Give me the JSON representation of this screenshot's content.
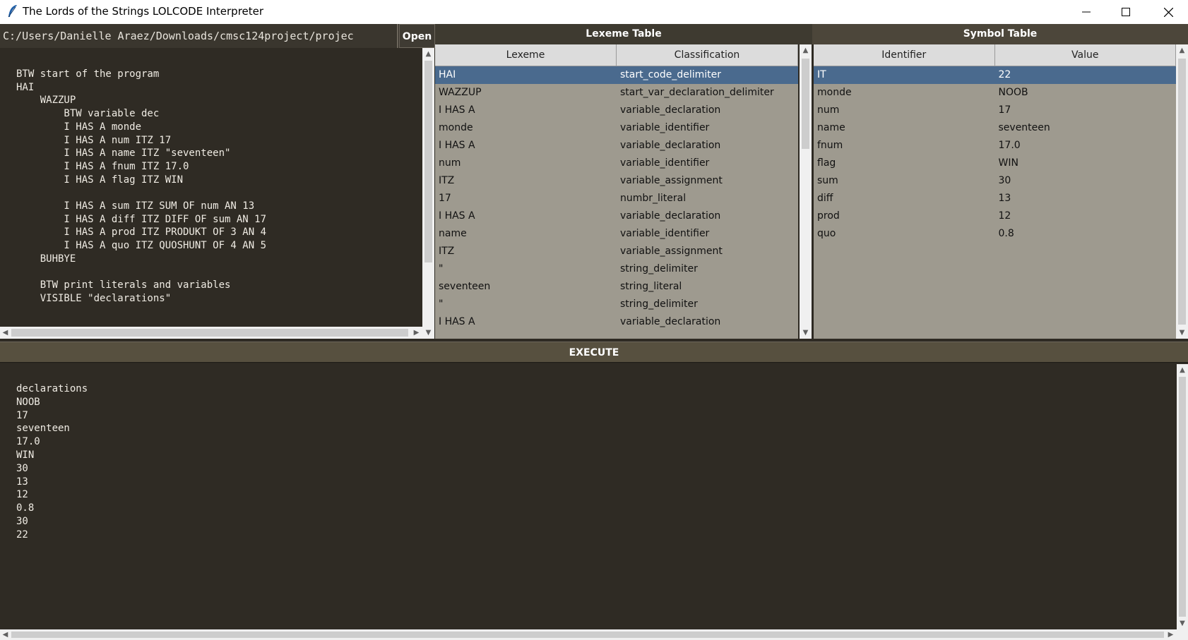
{
  "window": {
    "title": "The Lords of the Strings LOLCODE Interpreter",
    "controls": {
      "minimize": "—",
      "maximize": "☐",
      "close": "✕"
    }
  },
  "file": {
    "path": "C:/Users/Danielle Araez/Downloads/cmsc124project/projec",
    "open_label": "Open"
  },
  "editor": {
    "code": "BTW start of the program\nHAI\n    WAZZUP\n        BTW variable dec\n        I HAS A monde\n        I HAS A num ITZ 17\n        I HAS A name ITZ \"seventeen\"\n        I HAS A fnum ITZ 17.0\n        I HAS A flag ITZ WIN\n\n        I HAS A sum ITZ SUM OF num AN 13\n        I HAS A diff ITZ DIFF OF sum AN 17\n        I HAS A prod ITZ PRODUKT OF 3 AN 4\n        I HAS A quo ITZ QUOSHUNT OF 4 AN 5\n    BUHBYE\n\n    BTW print literals and variables\n    VISIBLE \"declarations\""
  },
  "lexeme_table": {
    "title": "Lexeme Table",
    "columns": [
      "Lexeme",
      "Classification"
    ],
    "selected_index": 0,
    "rows": [
      [
        "HAI",
        "start_code_delimiter"
      ],
      [
        "WAZZUP",
        "start_var_declaration_delimiter"
      ],
      [
        "I HAS A",
        "variable_declaration"
      ],
      [
        "monde",
        "variable_identifier"
      ],
      [
        "I HAS A",
        "variable_declaration"
      ],
      [
        "num",
        "variable_identifier"
      ],
      [
        "ITZ",
        "variable_assignment"
      ],
      [
        "17",
        "numbr_literal"
      ],
      [
        "I HAS A",
        "variable_declaration"
      ],
      [
        "name",
        "variable_identifier"
      ],
      [
        "ITZ",
        "variable_assignment"
      ],
      [
        "\"",
        "string_delimiter"
      ],
      [
        "seventeen",
        "string_literal"
      ],
      [
        "\"",
        "string_delimiter"
      ],
      [
        "I HAS A",
        "variable_declaration"
      ]
    ]
  },
  "symbol_table": {
    "title": "Symbol Table",
    "columns": [
      "Identifier",
      "Value"
    ],
    "selected_index": 0,
    "rows": [
      [
        "IT",
        "22"
      ],
      [
        "monde",
        "NOOB"
      ],
      [
        "num",
        "17"
      ],
      [
        "name",
        "seventeen"
      ],
      [
        "fnum",
        "17.0"
      ],
      [
        "flag",
        "WIN"
      ],
      [
        "sum",
        "30"
      ],
      [
        "diff",
        "13"
      ],
      [
        "prod",
        "12"
      ],
      [
        "quo",
        "0.8"
      ]
    ]
  },
  "execute": {
    "label": "EXECUTE"
  },
  "console": {
    "output": "declarations\nNOOB\n17\nseventeen\n17.0\nWIN\n30\n13\n12\n0.8\n30\n22"
  },
  "colors": {
    "background": "#2f2b24",
    "header": "#3e3a30",
    "table_bg": "#9e9a8f",
    "selection": "#4a6a8e"
  }
}
